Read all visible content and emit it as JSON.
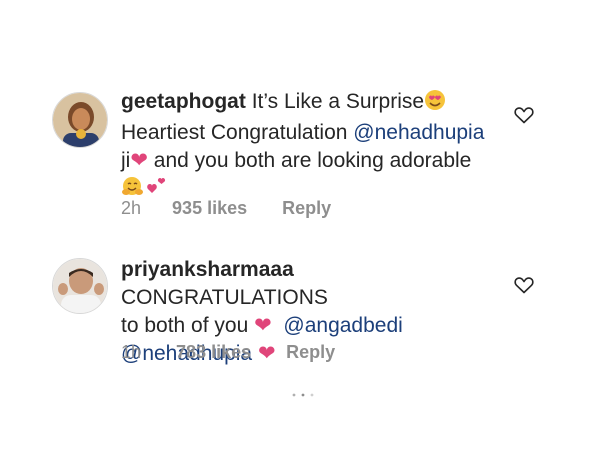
{
  "comments": [
    {
      "username": "geetaphogat",
      "line1": "It’s Like a Surprise",
      "line2_prefix": "Heartiest Congratulation ",
      "mention1": "@nehadhupia",
      "line3_prefix": "ji",
      "line3_suffix": " and you both are looking adorable",
      "time": "2h",
      "likes": "935 likes",
      "reply": "Reply"
    },
    {
      "username": "priyanksharmaaa",
      "line1": "CONGRATULATIONS",
      "line2_prefix": "to both of you ",
      "mention1": "@angadbedi",
      "mention2": "@nehadhupia",
      "time": "1h",
      "likes": "783 likes",
      "reply": "Reply"
    }
  ],
  "icons": {
    "like": "heart-outline-icon",
    "heart": "pink-heart-emoji",
    "loader": "loading-dots-icon"
  },
  "colors": {
    "mention": "#1c3f7a",
    "heart": "#e0457a",
    "meta": "#8e8e8e"
  }
}
